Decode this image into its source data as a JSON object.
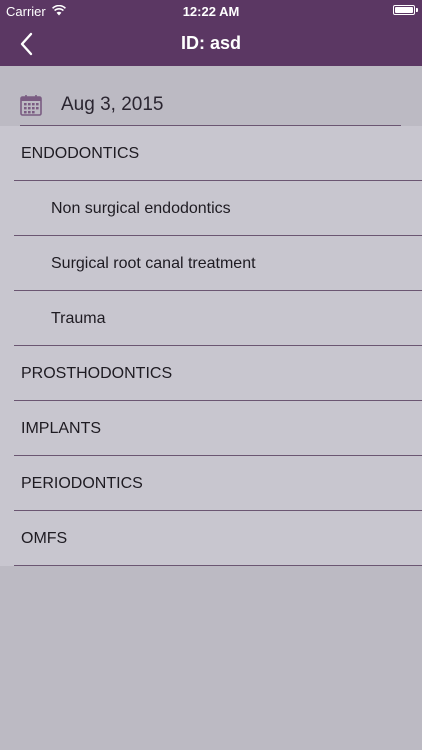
{
  "status_bar": {
    "carrier": "Carrier",
    "time": "12:22 AM",
    "wifi_icon": "wifi-icon",
    "battery_icon": "battery-icon"
  },
  "nav": {
    "title": "ID: asd",
    "back_icon": "chevron-left-icon"
  },
  "date_field": {
    "icon": "calendar-icon",
    "value": "Aug 3, 2015"
  },
  "list": {
    "rows": [
      {
        "label": "ENDODONTICS",
        "kind": "section"
      },
      {
        "label": "Non surgical endodontics",
        "kind": "sub"
      },
      {
        "label": "Surgical root canal treatment",
        "kind": "sub"
      },
      {
        "label": "Trauma",
        "kind": "sub"
      },
      {
        "label": "PROSTHODONTICS",
        "kind": "section"
      },
      {
        "label": "IMPLANTS",
        "kind": "section"
      },
      {
        "label": "PERIODONTICS",
        "kind": "section"
      },
      {
        "label": "OMFS",
        "kind": "section"
      }
    ]
  },
  "colors": {
    "nav_background": "#5b3763",
    "list_background": "#c8c6cf",
    "page_background": "#bcbac3",
    "separator": "#6b5672",
    "text": "#1e1b22"
  }
}
